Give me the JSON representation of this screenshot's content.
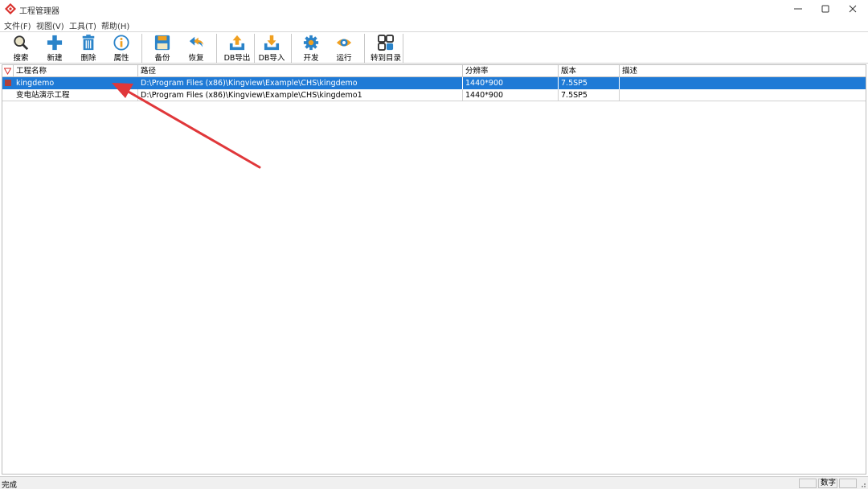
{
  "window": {
    "title": "工程管理器",
    "minimize_icon": "minimize-icon",
    "maximize_icon": "maximize-icon",
    "close_icon": "close-icon"
  },
  "menu": [
    {
      "label": "文件(F)"
    },
    {
      "label": "视图(V)"
    },
    {
      "label": "工具(T)"
    },
    {
      "label": "帮助(H)"
    }
  ],
  "toolbar": {
    "buttons": [
      {
        "label": "搜索",
        "icon": "search-icon"
      },
      {
        "label": "新建",
        "icon": "plus-icon"
      },
      {
        "label": "删除",
        "icon": "trash-icon"
      },
      {
        "label": "属性",
        "icon": "info-icon"
      },
      {
        "label": "备份",
        "icon": "save-icon"
      },
      {
        "label": "恢复",
        "icon": "undo-arrow-icon"
      },
      {
        "label": "DB导出",
        "icon": "upload-tray-icon"
      },
      {
        "label": "DB导入",
        "icon": "download-tray-icon"
      },
      {
        "label": "开发",
        "icon": "gear-icon"
      },
      {
        "label": "运行",
        "icon": "eye-icon"
      },
      {
        "label": "转到目录",
        "icon": "grid-icon"
      }
    ]
  },
  "table": {
    "columns": [
      "工程名称",
      "路径",
      "分辨率",
      "版本",
      "描述"
    ],
    "rows": [
      {
        "name": "kingdemo",
        "path": "D:\\Program Files (x86)\\Kingview\\Example\\CHS\\kingdemo",
        "resolution": "1440*900",
        "version": "7.5SP5",
        "description": "",
        "selected": true
      },
      {
        "name": "变电站演示工程",
        "path": "D:\\Program Files (x86)\\Kingview\\Example\\CHS\\kingdemo1",
        "resolution": "1440*900",
        "version": "7.5SP5",
        "description": "",
        "selected": false
      }
    ]
  },
  "status": {
    "text": "完成",
    "indicator": "数字"
  },
  "colors": {
    "selection": "#1f7ad6",
    "annotation_arrow": "#e0373a"
  }
}
